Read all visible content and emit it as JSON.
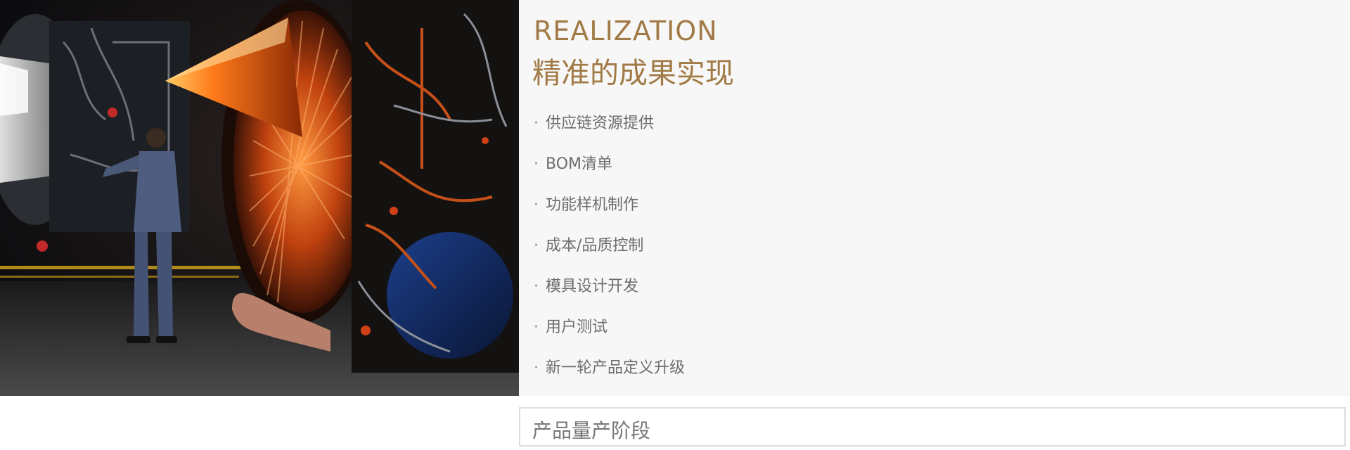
{
  "hero": {
    "image_alt": "Technician inspecting a jet engine",
    "icon": "jet-engine-photo"
  },
  "panel": {
    "title_en": "REALIZATION",
    "title_cn": "精准的成果实现",
    "bullet": "·",
    "items": [
      {
        "label": "供应链资源提供"
      },
      {
        "label": "BOM清单"
      },
      {
        "label": "功能样机制作"
      },
      {
        "label": "成本/品质控制"
      },
      {
        "label": "模具设计开发"
      },
      {
        "label": "用户测试"
      },
      {
        "label": "新一轮产品定义升级"
      }
    ]
  },
  "stage": {
    "label": "产品量产阶段"
  },
  "colors": {
    "accent": "#a17a45",
    "text_muted": "#6d6d6d",
    "panel_bg": "#f7f7f7",
    "border": "#dedede"
  }
}
